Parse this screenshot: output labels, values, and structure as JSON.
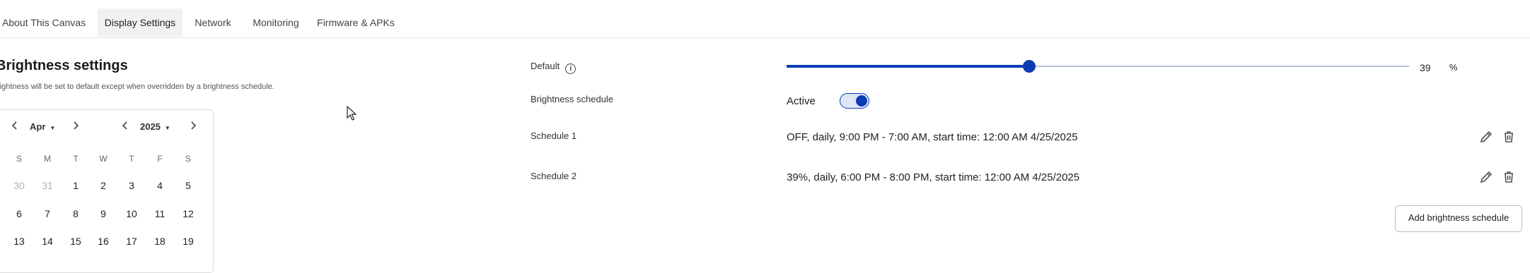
{
  "tabs": [
    "About This Canvas",
    "Display Settings",
    "Network",
    "Monitoring",
    "Firmware & APKs"
  ],
  "active_tab": "Display Settings",
  "brightness": {
    "title": "Brightness settings",
    "subtitle": "rightness will be set to default except when overridden by a brightness schedule."
  },
  "calendar": {
    "month": "Apr",
    "year": "2025",
    "days_of_week": [
      "S",
      "M",
      "T",
      "W",
      "T",
      "F",
      "S"
    ],
    "weeks": [
      [
        "30",
        "31",
        "1",
        "2",
        "3",
        "4",
        "5"
      ],
      [
        "6",
        "7",
        "8",
        "9",
        "10",
        "11",
        "12"
      ],
      [
        "13",
        "14",
        "15",
        "16",
        "17",
        "18",
        "19"
      ]
    ],
    "muted_days": [
      "30",
      "31"
    ]
  },
  "default": {
    "label": "Default",
    "value": "39",
    "unit": "%",
    "level_percent": 39
  },
  "schedule_toggle": {
    "label": "Brightness schedule",
    "status": "Active",
    "on": true
  },
  "schedules": [
    {
      "name": "Schedule 1",
      "text": "OFF, daily, 9:00 PM - 7:00 AM, start time: 12:00 AM 4/25/2025"
    },
    {
      "name": "Schedule 2",
      "text": "39%, daily, 6:00 PM - 8:00 PM, start time: 12:00 AM 4/25/2025"
    }
  ],
  "add_button": "Add brightness schedule",
  "colors": {
    "accent": "#0c3cb4",
    "track": "#b9c3d8",
    "tab_active_bg": "#f1f1f1"
  },
  "icons": [
    "info-icon",
    "chevron-left-icon",
    "chevron-right-icon",
    "pencil-icon",
    "trash-icon",
    "mouse-cursor-icon"
  ]
}
